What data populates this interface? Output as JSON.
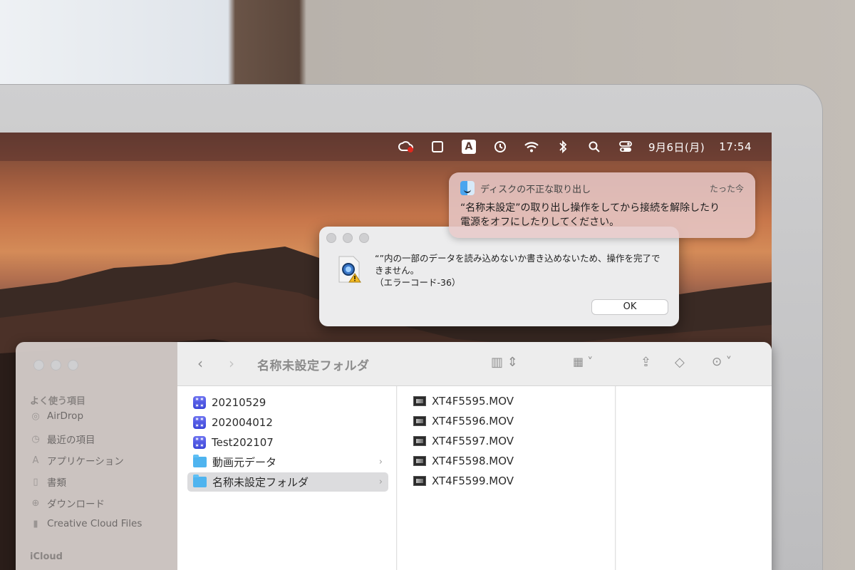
{
  "menubar": {
    "date": "9月6日(月)",
    "time": "17:54",
    "input_badge": "A",
    "icons": [
      "creative-cloud-icon",
      "screen-mirror-icon",
      "input-source-icon",
      "time-machine-icon",
      "wifi-icon",
      "bluetooth-icon",
      "spotlight-search-icon",
      "control-center-icon"
    ]
  },
  "notification": {
    "title": "ディスクの不正な取り出し",
    "time": "たった今",
    "body_line1": "“名称未設定”の取り出し操作をしてから接続を解除したり",
    "body_line2": "電源をオフにしたりしてください。"
  },
  "alert": {
    "line1": "“”内の一部のデータを読み込めないか書き込めないため、操作を完了で",
    "line2": "きません。",
    "line3": "（エラーコード-36）",
    "ok_label": "OK"
  },
  "finder": {
    "title": "名称未設定フォルダ",
    "sidebar": {
      "favorites_heading": "よく使う項目",
      "items": [
        {
          "label": "AirDrop",
          "icon": "airdrop-icon"
        },
        {
          "label": "最近の項目",
          "icon": "clock-icon"
        },
        {
          "label": "アプリケーション",
          "icon": "applications-icon"
        },
        {
          "label": "書類",
          "icon": "document-icon"
        },
        {
          "label": "ダウンロード",
          "icon": "download-icon"
        },
        {
          "label": "Creative Cloud Files",
          "icon": "file-icon"
        }
      ],
      "icloud_heading": "iCloud"
    },
    "column1": [
      {
        "label": "20210529",
        "type": "app"
      },
      {
        "label": "202004012",
        "type": "app"
      },
      {
        "label": "Test202107",
        "type": "app"
      },
      {
        "label": "動画元データ",
        "type": "folder"
      },
      {
        "label": "名称未設定フォルダ",
        "type": "folder",
        "selected": true
      }
    ],
    "column2": [
      {
        "label": "XT4F5595.MOV"
      },
      {
        "label": "XT4F5596.MOV"
      },
      {
        "label": "XT4F5597.MOV"
      },
      {
        "label": "XT4F5598.MOV"
      },
      {
        "label": "XT4F5599.MOV"
      }
    ]
  }
}
